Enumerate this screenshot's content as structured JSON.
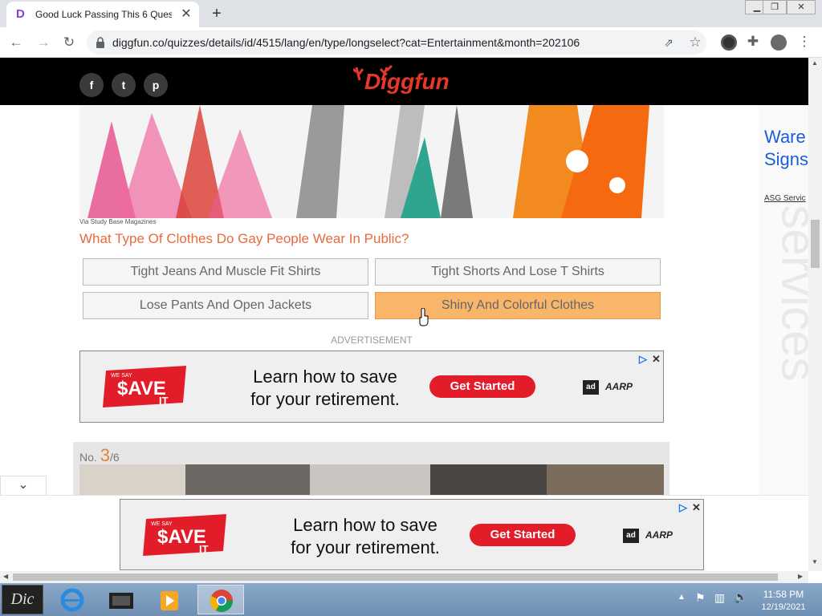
{
  "browser": {
    "tab_title": "Good Luck Passing This 6 Questi",
    "tab_favicon": "D",
    "url": "diggfun.co/quizzes/details/id/4515/lang/en/type/longselect?cat=Entertainment&month=202106",
    "close_glyph": "✕",
    "newtab_glyph": "+",
    "icons": [
      "back-icon",
      "forward-icon",
      "reload-icon",
      "lock-icon",
      "share-icon",
      "star-icon",
      "extension-icon",
      "puzzle-icon",
      "profile-icon",
      "menu-icon"
    ]
  },
  "site": {
    "logo_text": "Diggfun",
    "social": [
      "f",
      "t",
      "p"
    ],
    "brand_color": "#e8372a"
  },
  "quiz": {
    "image_caption": "Via Study Base Magazines",
    "question": "What Type Of Clothes Do Gay People Wear In Public?",
    "answers": [
      {
        "label": "Tight Jeans And Muscle Fit Shirts",
        "selected": false
      },
      {
        "label": "Tight Shorts And Lose T Shirts",
        "selected": false
      },
      {
        "label": "Lose Pants And Open Jackets",
        "selected": false
      },
      {
        "label": "Shiny And Colorful Clothes",
        "selected": true
      }
    ],
    "advertisement_label": "ADVERTISEMENT",
    "next": {
      "prefix": "No.",
      "number": "3",
      "total": "/6"
    }
  },
  "ad": {
    "badge_top": "WE SAY",
    "badge_main": "$AVE",
    "badge_sub": "IT",
    "headline_line1": "Learn how to save",
    "headline_line2": "for your retirement.",
    "cta": "Get Started",
    "brand_ad": "ad",
    "brand": "AARP",
    "choices": "▷",
    "close": "✕"
  },
  "side_ad": {
    "text1": "Ware",
    "text2": "Signs",
    "sponsor": "ASG Servic",
    "watermark": "services"
  },
  "taskbar": {
    "time": "11:58 PM",
    "date": "12/19/2021",
    "start_label": "Dic"
  }
}
